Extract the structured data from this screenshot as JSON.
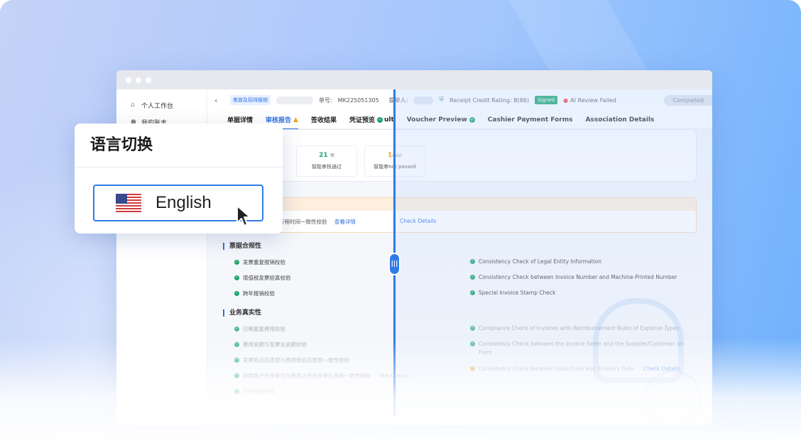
{
  "popup": {
    "title": "语言切换",
    "selected_language": "English"
  },
  "sidebar": {
    "items": [
      {
        "label": "个人工作台",
        "icon": "home-icon"
      },
      {
        "label": "我的账本",
        "icon": "book-icon"
      }
    ]
  },
  "header": {
    "category_tag": "差旅及招待报销",
    "doc_no_label": "单号:",
    "doc_no": "MK225051305",
    "submitter_label": "提单人:",
    "credit_rating": "Receipt Credit Rating: B(86)",
    "signed_badge": "Signed",
    "ai_review": "AI Review Failed",
    "status": "Completed"
  },
  "tabs": [
    {
      "label": "单据详情"
    },
    {
      "label": "审核报告"
    },
    {
      "label": "签收结果"
    },
    {
      "label": "凭证预览"
    },
    {
      "label": "ult"
    },
    {
      "label": "Voucher Preview"
    },
    {
      "label": "Cashier Payment Forms"
    },
    {
      "label": "Association Details"
    }
  ],
  "summary": {
    "passed_count": "21",
    "passed_unit": "项",
    "passed_label": "智能审核通过",
    "failed_count": "1",
    "failed_unit": "m(s)",
    "failed_label_cn": "智能审",
    "failed_label_en": "not passed"
  },
  "alert": {
    "item": "差报销单行程时间一致性校验",
    "link_cn": "查看详情",
    "link_en": "Check Details"
  },
  "sections": {
    "invoice_compliance": "票据合规性",
    "business_authenticity": "业务真实性"
  },
  "checks_cn": [
    "发票重复报销校验",
    "增值税发票验真校验",
    "跨年报销校验",
    "日期重复费用校验",
    "费用金额与发票总金额校验",
    "发票商品应类型与费用商品应类型一致性校验",
    "收款账户往来单位与费用上的往来单位名称一致性校验",
    "行程报销校验"
  ],
  "checks_cn_tail": "the One on",
  "checks_en": [
    "Consistency Check of Legal Entity Information",
    "Consistency Check between Invoice Number and Machine-Printed Number",
    "Special Invoice Stamp Check",
    "Compliance Check of Invoices with Reimbursement Rules of Expense Types",
    "Consistency Check between the Invoice Seller and the Supplier/Customer on",
    "Form",
    "Consistency Check Between Issue Date and Itinerary Date",
    "Check Details"
  ],
  "colors": {
    "accent": "#2f7bea",
    "success": "#1aa46a",
    "warning": "#f0a020"
  }
}
